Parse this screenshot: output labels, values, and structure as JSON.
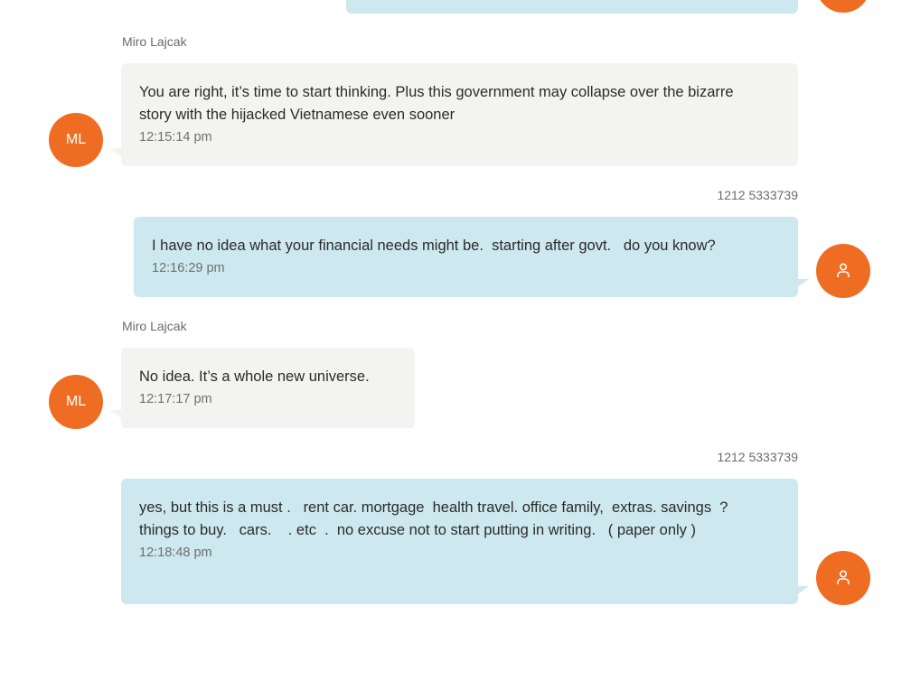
{
  "messages": [
    {
      "sender": "Miro Lajcak",
      "initials": "ML",
      "text": "You are right, it’s time to start thinking. Plus this government may collapse over the bizarre story with the hijacked Vietnamese even sooner",
      "time": "12:15:14 pm"
    },
    {
      "sender": "1212 5333739",
      "text": "I have no idea what your financial needs might be.  starting after govt.   do you know?",
      "time": "12:16:29 pm"
    },
    {
      "sender": "Miro Lajcak",
      "initials": "ML",
      "text": "No idea. It’s a whole new universe.",
      "time": "12:17:17 pm"
    },
    {
      "sender": "1212 5333739",
      "text": "yes, but this is a must .   rent car. mortgage  health travel. office family,  extras. savings  ?  things to buy.   cars.    . etc  .  no excuse not to start putting in writing.   ( paper only )",
      "time": "12:18:48 pm"
    }
  ],
  "icons": {
    "outgoing_avatar": "person-icon"
  },
  "colors": {
    "avatar": "#ef6c23",
    "incoming_bubble": "#f3f3f2",
    "outgoing_bubble": "#cde8ee"
  }
}
